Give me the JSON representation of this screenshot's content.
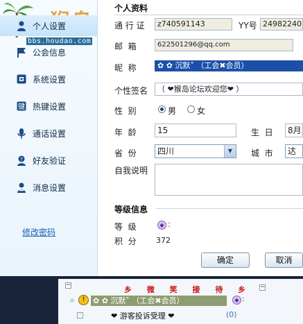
{
  "sidebar": {
    "watermark": "猴岛",
    "site": "bbs.houdao.com",
    "items": [
      {
        "label": "个人设置",
        "icon": "person-icon",
        "active": true
      },
      {
        "label": "公会信息",
        "icon": "flag-icon",
        "active": false
      },
      {
        "label": "系统设置",
        "icon": "settings-icon",
        "active": false
      },
      {
        "label": "热键设置",
        "icon": "hotkey-icon",
        "active": false
      },
      {
        "label": "通话设置",
        "icon": "microphone-icon",
        "active": false
      },
      {
        "label": "好友验证",
        "icon": "verify-icon",
        "active": false
      },
      {
        "label": "消息设置",
        "icon": "message-user-icon",
        "active": false
      }
    ],
    "change_password": "修改密码"
  },
  "profile": {
    "section_title": "个人资料",
    "pass_label": "通 行 证",
    "pass_value": "z740591143",
    "yy_label": "YY号",
    "yy_value": "24982240",
    "email_label": "邮  箱",
    "email_value": "622501296@qq.com",
    "nick_label": "昵  称",
    "nick_value": "✿  ✿      沉默˚   （工会✖会员）",
    "sign_label": "个性签名",
    "sign_value": "（ ❤猴岛论坛欢迎您❤ ）",
    "gender_label": "性  别",
    "gender_male": "男",
    "gender_female": "女",
    "gender_selected": "男",
    "age_label": "年  龄",
    "age_value": "15",
    "birthday_label": "生  日",
    "birthday_value": "8月",
    "province_label": "省  份",
    "province_value": "四川",
    "city_label": "城  市",
    "city_value": "达州",
    "intro_label": "自我说明",
    "intro_value": ""
  },
  "level": {
    "section_title": "等级信息",
    "grade_label": "等  级",
    "grade_icon": "level-badge-icon",
    "points_label": "积  分",
    "points_value": "372"
  },
  "buttons": {
    "ok": "确定",
    "cancel": "取消"
  },
  "channel": {
    "greeting": "乡 微 笑 接 待 乡",
    "member": "✿  ✿     沉默˚  （工会✖会员）",
    "complaint": "❤    游客投诉受理    ❤",
    "count": "(0)"
  },
  "colors": {
    "accent": "#1c4fa8",
    "greeting": "#cc1111",
    "bottom_bg": "#17243a",
    "member_bg": "#8e9c71"
  }
}
